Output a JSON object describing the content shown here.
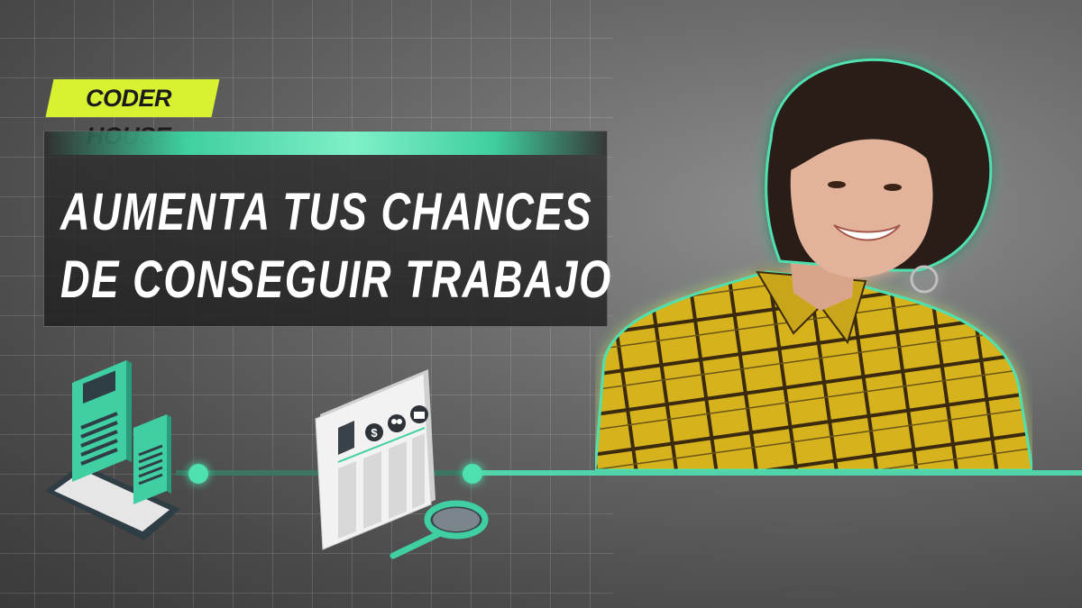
{
  "brand": {
    "label": "CODER HOUSE"
  },
  "headline": {
    "line1": "AUMENTA TUS CHANCES",
    "line2": "DE CONSEGUIR TRABAJO"
  },
  "icons": {
    "phone_icon": "smartphone-with-profiles-icon",
    "newspaper_icon": "newspaper-job-listings-icon",
    "magnifier_icon": "magnifying-glass-icon",
    "dollar_symbol": "$"
  },
  "colors": {
    "accent_green": "#4fe0b0",
    "brand_yellow": "#d8f232",
    "shirt_yellow": "#d6b31f"
  }
}
